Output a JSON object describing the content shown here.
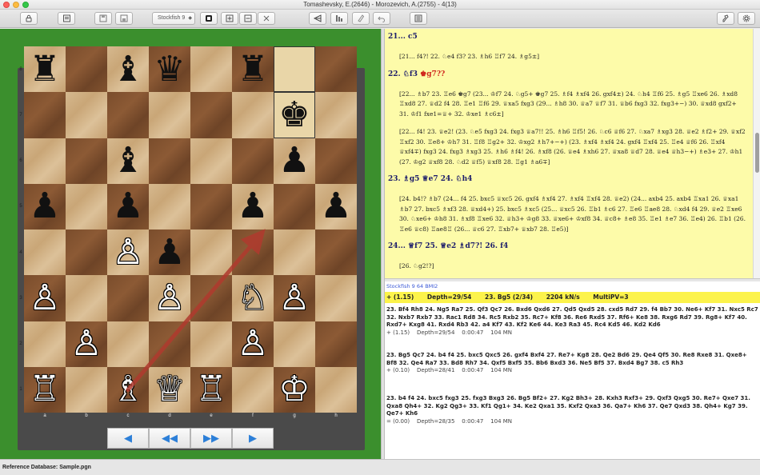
{
  "window": {
    "title": "Tomashevsky, E.(2646) - Morozevich, A.(2755) - 4(13)"
  },
  "toolbar": {
    "engine_selected": "Stockfish 9",
    "icons": [
      "lock-icon",
      "database-icon",
      "save-icon",
      "save-as-icon",
      "engine-select",
      "engine-toggle-icon",
      "add-engine-icon",
      "remove-engine-icon",
      "close-engine-icon",
      "flip-board-icon",
      "setup-position-icon",
      "annotate-icon",
      "take-back-icon",
      "notation-icon",
      "board-settings-icon",
      "settings-gear-icon"
    ]
  },
  "board": {
    "files": [
      "a",
      "b",
      "c",
      "d",
      "e",
      "f",
      "g",
      "h"
    ],
    "ranks": [
      "8",
      "7",
      "6",
      "5",
      "4",
      "3",
      "2",
      "1"
    ],
    "highlighted": [
      "g8",
      "g7"
    ],
    "arrow": {
      "from": "c1",
      "to": "f4",
      "color": "#b03a2e"
    },
    "pieces": [
      {
        "sq": "a8",
        "glyph": "♜",
        "side": "b"
      },
      {
        "sq": "c8",
        "glyph": "♝",
        "side": "b"
      },
      {
        "sq": "d8",
        "glyph": "♛",
        "side": "b"
      },
      {
        "sq": "f8",
        "glyph": "♜",
        "side": "b"
      },
      {
        "sq": "g7",
        "glyph": "♚",
        "side": "b"
      },
      {
        "sq": "c6",
        "glyph": "♝",
        "side": "b"
      },
      {
        "sq": "g6",
        "glyph": "♟",
        "side": "b"
      },
      {
        "sq": "a5",
        "glyph": "♟",
        "side": "b"
      },
      {
        "sq": "c5",
        "glyph": "♟",
        "side": "b"
      },
      {
        "sq": "f5",
        "glyph": "♟",
        "side": "b"
      },
      {
        "sq": "h5",
        "glyph": "♟",
        "side": "b"
      },
      {
        "sq": "d4",
        "glyph": "♟",
        "side": "b"
      },
      {
        "sq": "c4",
        "glyph": "♙",
        "side": "w"
      },
      {
        "sq": "a3",
        "glyph": "♙",
        "side": "w"
      },
      {
        "sq": "d3",
        "glyph": "♙",
        "side": "w"
      },
      {
        "sq": "f3",
        "glyph": "♘",
        "side": "w"
      },
      {
        "sq": "g3",
        "glyph": "♙",
        "side": "w"
      },
      {
        "sq": "b2",
        "glyph": "♙",
        "side": "w"
      },
      {
        "sq": "f2",
        "glyph": "♙",
        "side": "w"
      },
      {
        "sq": "a1",
        "glyph": "♖",
        "side": "w"
      },
      {
        "sq": "c1",
        "glyph": "♗",
        "side": "w"
      },
      {
        "sq": "d1",
        "glyph": "♕",
        "side": "w"
      },
      {
        "sq": "e1",
        "glyph": "♖",
        "side": "w"
      },
      {
        "sq": "g1",
        "glyph": "♔",
        "side": "w"
      }
    ]
  },
  "nav": {
    "prev": "◀",
    "first": "◀◀",
    "last": "▶▶",
    "next": "▶"
  },
  "notation": {
    "lines": [
      {
        "type": "main",
        "text": "21... c5"
      },
      {
        "type": "var",
        "text": "[21... f4?! 22. ♘e4 f3? 23. ♗h6 ♖f7 24. ♗g5±]"
      },
      {
        "type": "main",
        "text": "22. ♘f3 ",
        "red": "♚g7??"
      },
      {
        "type": "var",
        "text": "[22... ♗b7 23. ♖e6 ♚g7 (23... ♔f7 24. ♘g5+ ♚g7 25. ♗f4 ♗xf4 26. gxf4±) 24. ♘h4 ♖f6 25. ♗g5 ♖xe6 26. ♗xd8 ♖xd8 27. ♕d2 f4 28. ♖e1 ♖f6 29. ♕xa5 fxg3 (29... ♗h8 30. ♕a7 ♕f7 31. ♕b6 fxg3 32. fxg3+−) 30. ♕xd8 gxf2+ 31. ♔f1 fxe1=♕+ 32. ♔xe1 ♗c6±]"
      },
      {
        "type": "var",
        "text": "[22... f4! 23. ♕e2! (23. ♘e5 fxg3 24. fxg3 ♕a7!! 25. ♗h6 ♖f5! 26. ♘c6 ♕f6 27. ♘xa7 ♗xg3 28. ♕e2 ♗f2+ 29. ♕xf2 ♖xf2 30. ♖e8+ ♔h7 31. ♖f8 ♖g2+ 32. ♔xg2 ♗h7+−+) (23. ♗xf4 ♗xf4 24. gxf4 ♖xf4 25. ♖e4 ♕f6 26. ♖xf4 ♕xf4∓) fxg3 24. fxg3 ♗xg3 25. ♗h6 ♗f4! 26. ♗xf8 (26. ♕e4 ♗xh6 27. ♕xa8 ♕d7 28. ♕e4 ♕h3−+) ♗e3+ 27. ♔h1 (27. ♔g2 ♕xf8 28. ♘d2 ♕f5) ♕xf8 28. ♖g1 ♗a6∓]"
      },
      {
        "type": "main",
        "text": "23. ♗g5 ♕e7 24. ♘h4"
      },
      {
        "type": "var",
        "text": "[24. b4!? ♗b7 (24... f4 25. bxc5 ♕xc5 26. gxf4 ♗xf4 27. ♗xf4 ♖xf4 28. ♕e2) (24... axb4 25. axb4 ♖xa1 26. ♕xa1 ♗b7 27. bxc5 ♗xf3 28. ♕xd4+) 25. bxc5 ♗xc5 (25... ♕xc5 26. ♖b1 ♗c6 27. ♖e6 ♖ae8 28. ♘xd4 f4 29. ♕e2 ♖xe6 30. ♘xe6+ ♔h8 31. ♗xf8 ♖xe6 32. ♕h3+ ♔g8 33. ♕xe6+ ♔xf8 34. ♕c8+ ♗e8 35. ♖e1 ♗e7 36. ♖e4) 26. ♖b1 (26. ♖e6 ♕c8) ♖ae8♖ (26... ♕c6 27. ♖xb7+ ♕xb7 28. ♖e5)]"
      },
      {
        "type": "main",
        "text": "24... ♕f7 25. ♕e2 ♗d7?! 26. f4"
      },
      {
        "type": "var",
        "text": "[26. ♘g2!?]"
      }
    ]
  },
  "engine": {
    "name": "Stockfish 9 64 BMI2",
    "status": {
      "eval": "+ (1.15)",
      "depth": "Depth=29/54",
      "move": "23. Bg5 (2/34)",
      "speed": "2204 kN/s",
      "multipv": "MultiPV=3"
    },
    "lines": [
      {
        "moves": "23. Bf4 Rh8 24. Ng5 Ra7 25. Qf3 Qc7 26. Bxd6 Qxd6 27. Qd5 Qxd5 28. cxd5 Rd7 29. f4 Bb7 30. Ne6+ Kf7 31. Nxc5 Rc7 32. Nxb7 Rxb7 33. Rac1 Rd8 34. Rc5 Rxb2 35. Rc7+ Kf8 36. Re6 Rxd5 37. Rf6+ Ke8 38. Rxg6 Rd7 39. Rg8+ Kf7 40. Rxd7+ Kxg8 41. Rxd4 Rb3 42. a4 Kf7 43. Kf2 Ke6 44. Ke3 Ra3 45. Rc4 Kd5 46. Kd2 Kd6",
        "info": "+ (1.15)    Depth=29/54    0:00:47    104 MN"
      },
      {
        "moves": "23. Bg5 Qc7 24. b4 f4 25. bxc5 Qxc5 26. gxf4 Bxf4 27. Re7+ Kg8 28. Qe2 Bd6 29. Qe4 Qf5 30. Re8 Rxe8 31. Qxe8+ Bf8 32. Qe4 Ra7 33. Bd8 Rh7 34. Qxf5 Bxf5 35. Bb6 Bxd3 36. Ne5 Bf5 37. Bxd4 Bg7 38. c5 Rh3",
        "info": "+ (0.10)    Depth=28/41    0:00:47    104 MN"
      },
      {
        "moves": "23. b4 f4 24. bxc5 fxg3 25. fxg3 Bxg3 26. Bg5 Bf2+ 27. Kg2 Bh3+ 28. Kxh3 Rxf3+ 29. Qxf3 Qxg5 30. Re7+ Qxe7 31. Qxa8 Qh4+ 32. Kg2 Qg3+ 33. Kf1 Qg1+ 34. Ke2 Qxa1 35. Kxf2 Qxa3 36. Qa7+ Kh6 37. Qe7 Qxd3 38. Qh4+ Kg7 39. Qe7+ Kh6",
        "info": "= (0.00)    Depth=28/35    0:00:47    104 MN"
      }
    ]
  },
  "statusbar": {
    "text": "Reference Database: Sample.pgn"
  }
}
